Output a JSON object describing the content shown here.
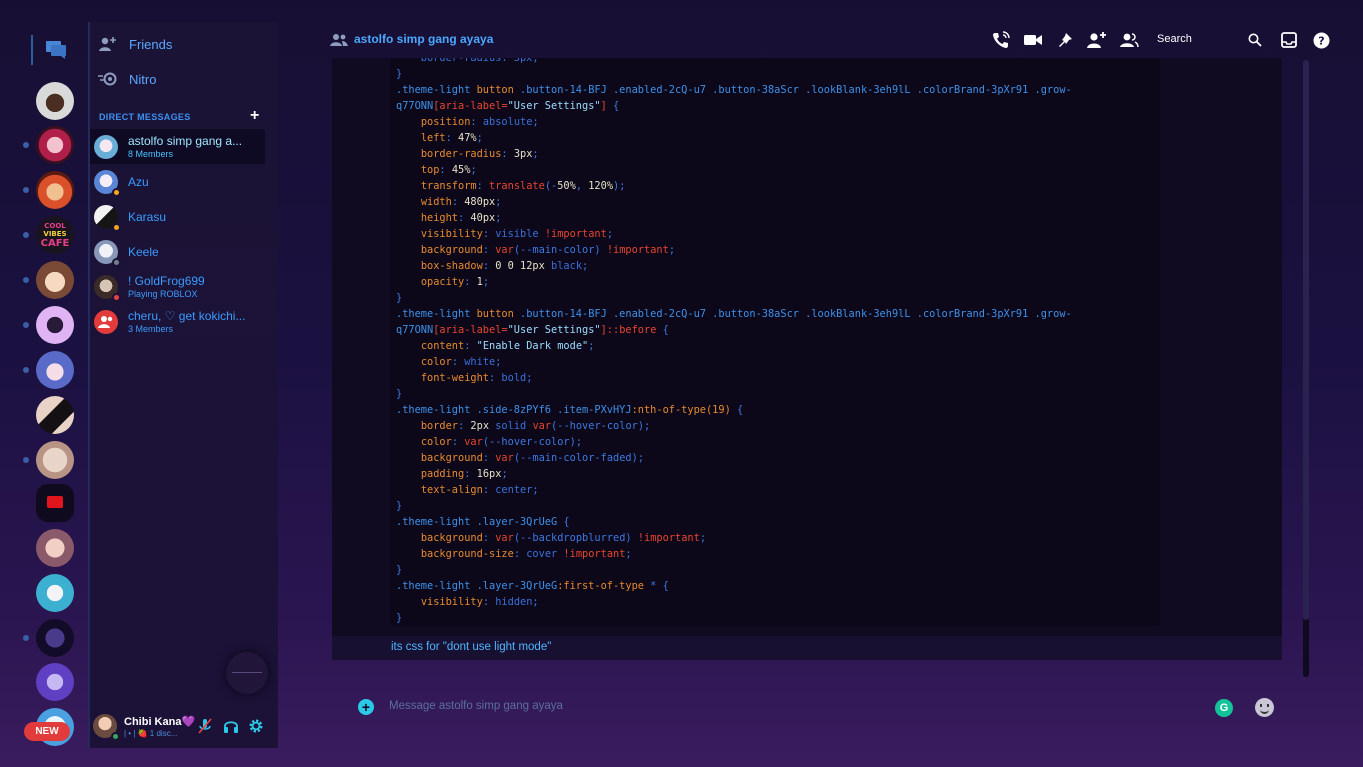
{
  "sidebar": {
    "friends_label": "Friends",
    "nitro_label": "Nitro",
    "direct_messages_header": "DIRECT MESSAGES",
    "dms": [
      {
        "name": "astolfo simp gang a...",
        "sub": "8 Members"
      },
      {
        "name": "Azu",
        "sub": ""
      },
      {
        "name": "Karasu",
        "sub": ""
      },
      {
        "name": "Keele",
        "sub": ""
      },
      {
        "name": "! GoldFrog699",
        "sub": "Playing ROBLOX"
      },
      {
        "name": "cheru, ♡ get kokichi...",
        "sub": "3 Members"
      }
    ]
  },
  "rail": {
    "new_badge": "NEW"
  },
  "user": {
    "name": "Chibi Kana💜",
    "status": "| • | 🍓 1 disc..."
  },
  "header": {
    "channel_name": "astolfo simp gang ayaya",
    "search_label": "Search"
  },
  "message": {
    "text": "its css for \"dont use light mode\""
  },
  "composer": {
    "placeholder": "Message astolfo simp gang ayaya",
    "grammarly_label": "G"
  },
  "colors": {
    "accent": "#3b9bff",
    "code_bg": "#0c081a",
    "brand_cyan": "#2bc8e8"
  }
}
